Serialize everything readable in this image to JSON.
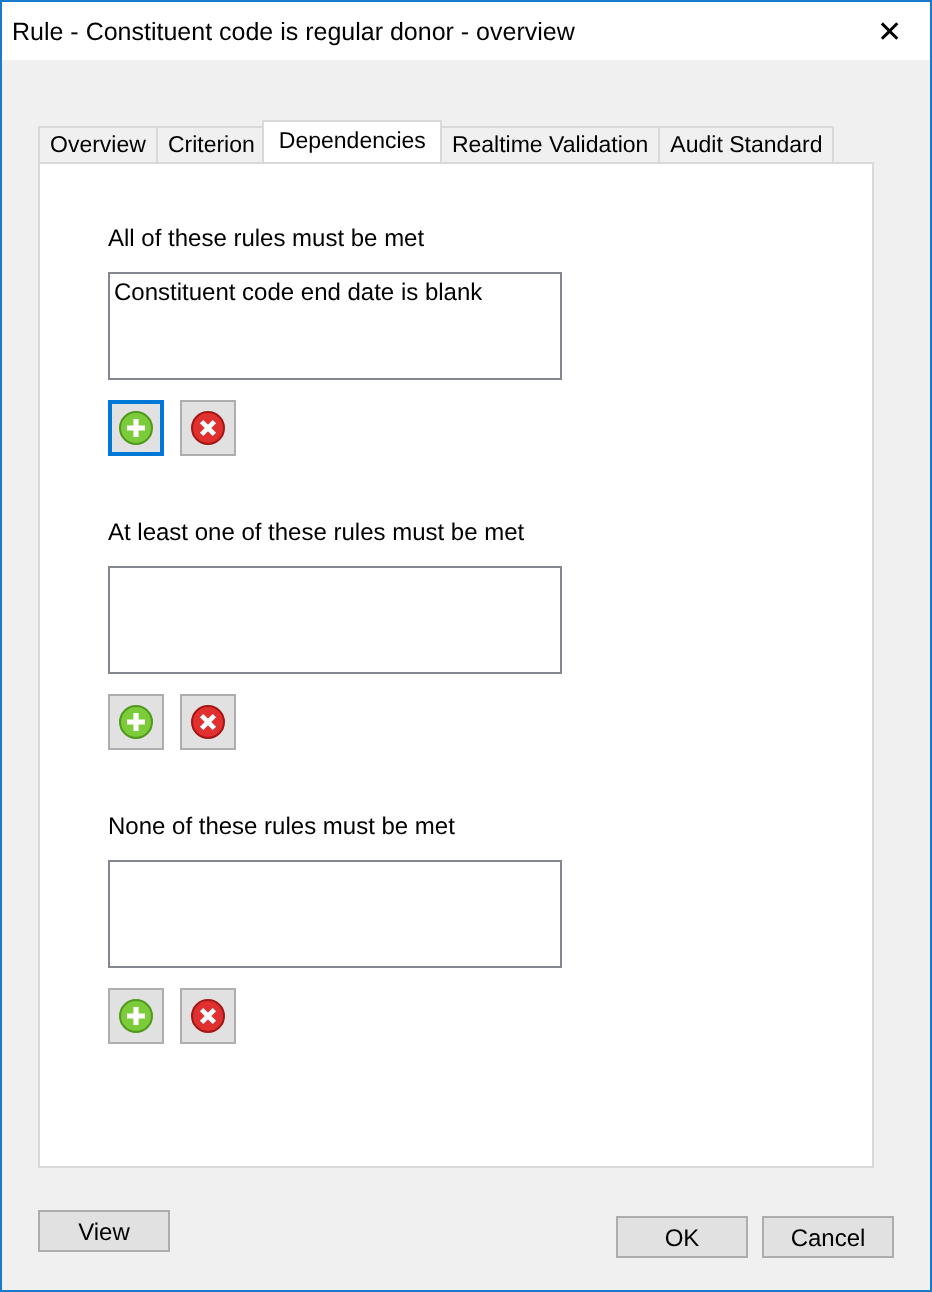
{
  "window": {
    "title": "Rule - Constituent code is regular donor - overview",
    "close": "✕"
  },
  "tabs": [
    {
      "label": "Overview",
      "selected": false
    },
    {
      "label": "Criterion",
      "selected": false
    },
    {
      "label": "Dependencies",
      "selected": true
    },
    {
      "label": "Realtime Validation",
      "selected": false
    },
    {
      "label": "Audit Standard",
      "selected": false
    }
  ],
  "groups": [
    {
      "label": "All of these rules must be met",
      "items": [
        "Constituent code end date is blank"
      ],
      "add_focused": true
    },
    {
      "label": "At least one of these rules must be met",
      "add_focused": false
    },
    {
      "label": "None of these rules must be met",
      "add_focused": false
    }
  ],
  "buttons": {
    "view": "View",
    "ok": "OK",
    "cancel": "Cancel"
  }
}
